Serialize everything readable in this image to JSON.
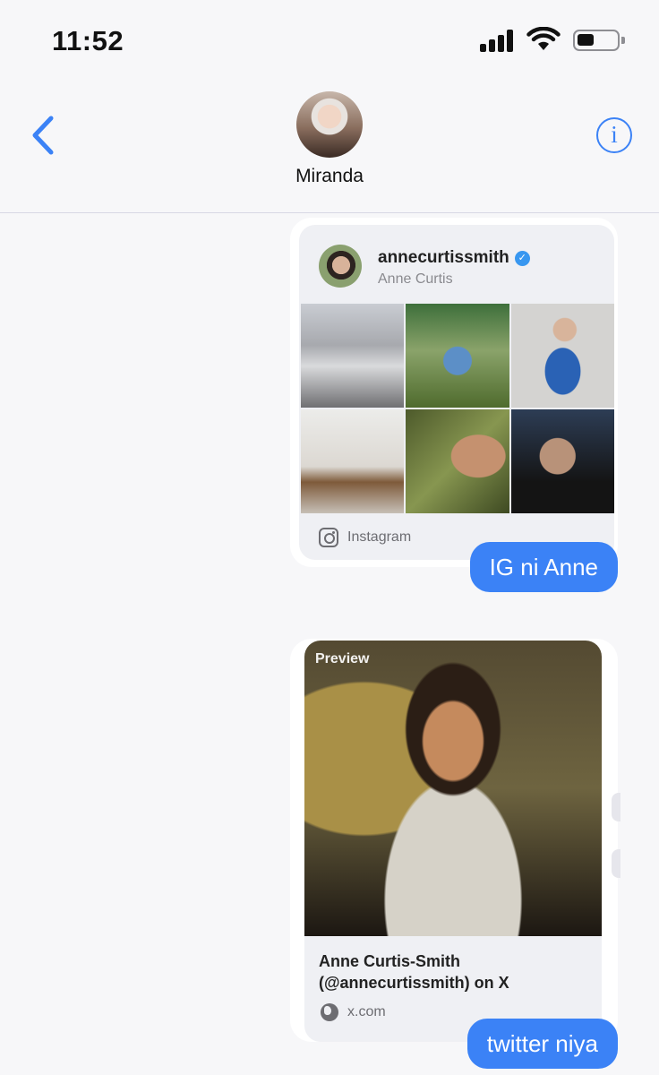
{
  "status_bar": {
    "time": "11:52"
  },
  "header": {
    "contact_name": "Miranda",
    "info_label": "i"
  },
  "messages": [
    {
      "type": "instagram-link-preview",
      "username": "annecurtissmith",
      "full_name": "Anne Curtis",
      "source": "Instagram",
      "text": "IG ni Anne"
    },
    {
      "type": "x-link-preview",
      "image_label": "Preview",
      "title": "Anne Curtis-Smith (@annecurtissmith) on X",
      "source": "x.com",
      "text": "twitter niya"
    }
  ],
  "colors": {
    "accent": "#3b82f6",
    "verified": "#3897f0"
  }
}
